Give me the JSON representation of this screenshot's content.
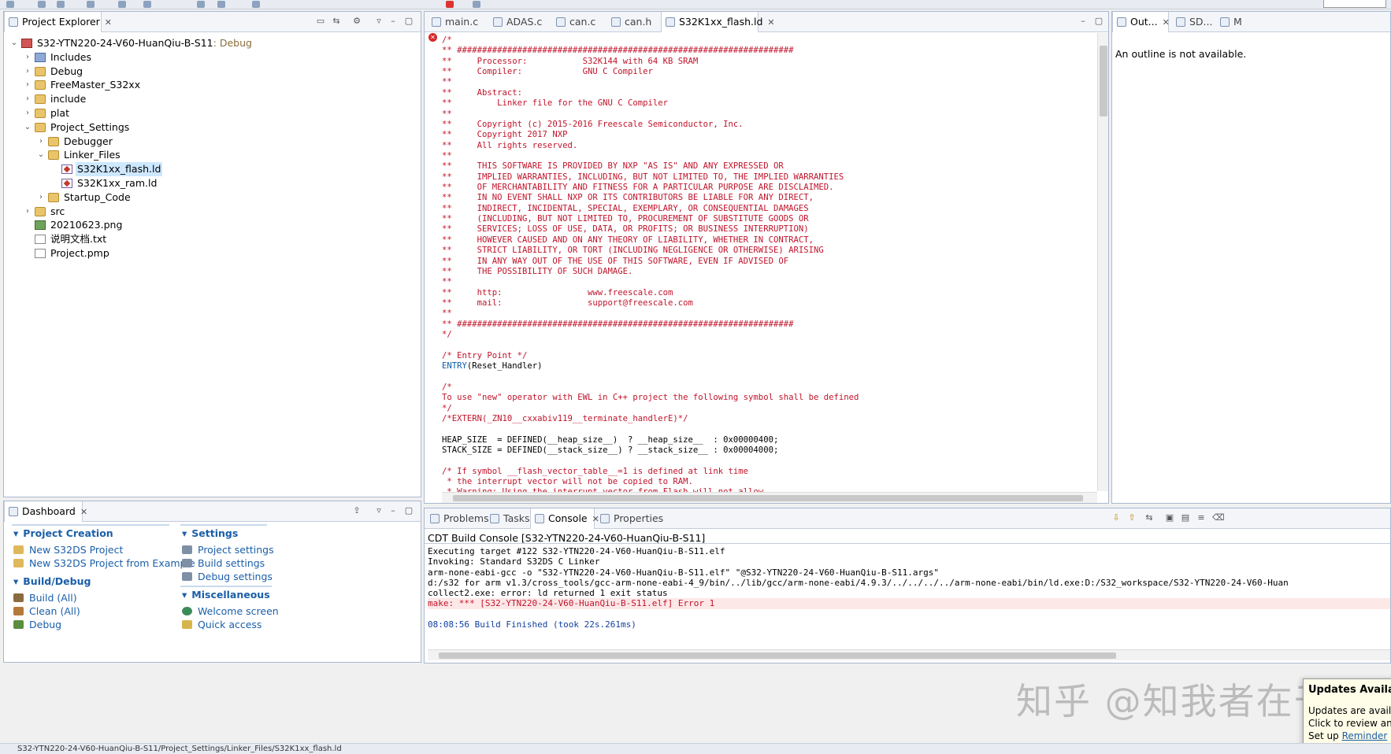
{
  "explorer": {
    "tab_label": "Project Explorer",
    "tree": [
      {
        "label": "S32-YTN220-24-V60-HuanQiu-B-S11",
        "decor": ": Debug",
        "depth": 0,
        "twisty": "open",
        "icon": "proj",
        "selected": false
      },
      {
        "label": "Includes",
        "depth": 1,
        "twisty": "closed",
        "icon": "incl"
      },
      {
        "label": "Debug",
        "depth": 1,
        "twisty": "closed",
        "icon": "folder"
      },
      {
        "label": "FreeMaster_S32xx",
        "depth": 1,
        "twisty": "closed",
        "icon": "folder"
      },
      {
        "label": "include",
        "depth": 1,
        "twisty": "closed",
        "icon": "folder"
      },
      {
        "label": "plat",
        "depth": 1,
        "twisty": "closed",
        "icon": "folder"
      },
      {
        "label": "Project_Settings",
        "depth": 1,
        "twisty": "open",
        "icon": "folder"
      },
      {
        "label": "Debugger",
        "depth": 2,
        "twisty": "closed",
        "icon": "folder"
      },
      {
        "label": "Linker_Files",
        "depth": 2,
        "twisty": "open",
        "icon": "folder"
      },
      {
        "label": "S32K1xx_flash.ld",
        "depth": 3,
        "twisty": "none",
        "icon": "ld",
        "selected": true
      },
      {
        "label": "S32K1xx_ram.ld",
        "depth": 3,
        "twisty": "none",
        "icon": "ld"
      },
      {
        "label": "Startup_Code",
        "depth": 2,
        "twisty": "closed",
        "icon": "folder"
      },
      {
        "label": "src",
        "depth": 1,
        "twisty": "closed",
        "icon": "folder"
      },
      {
        "label": "20210623.png",
        "depth": 1,
        "twisty": "none",
        "icon": "png"
      },
      {
        "label": "说明文档.txt",
        "depth": 1,
        "twisty": "none",
        "icon": "file"
      },
      {
        "label": "Project.pmp",
        "depth": 1,
        "twisty": "none",
        "icon": "file"
      }
    ]
  },
  "editor": {
    "tabs": [
      {
        "label": "main.c",
        "active": false
      },
      {
        "label": "ADAS.c",
        "active": false
      },
      {
        "label": "can.c",
        "active": false
      },
      {
        "label": "can.h",
        "active": false
      },
      {
        "label": "S32K1xx_flash.ld",
        "active": true
      }
    ],
    "lines": [
      {
        "t": "/*"
      },
      {
        "t": "** ###################################################################"
      },
      {
        "t": "**     Processor:           S32K144 with 64 KB SRAM"
      },
      {
        "t": "**     Compiler:            GNU C Compiler"
      },
      {
        "t": "**"
      },
      {
        "t": "**     Abstract:"
      },
      {
        "t": "**         Linker file for the GNU C Compiler"
      },
      {
        "t": "**"
      },
      {
        "t": "**     Copyright (c) 2015-2016 Freescale Semiconductor, Inc."
      },
      {
        "t": "**     Copyright 2017 NXP"
      },
      {
        "t": "**     All rights reserved."
      },
      {
        "t": "**"
      },
      {
        "t": "**     THIS SOFTWARE IS PROVIDED BY NXP \"AS IS\" AND ANY EXPRESSED OR"
      },
      {
        "t": "**     IMPLIED WARRANTIES, INCLUDING, BUT NOT LIMITED TO, THE IMPLIED WARRANTIES"
      },
      {
        "t": "**     OF MERCHANTABILITY AND FITNESS FOR A PARTICULAR PURPOSE ARE DISCLAIMED."
      },
      {
        "t": "**     IN NO EVENT SHALL NXP OR ITS CONTRIBUTORS BE LIABLE FOR ANY DIRECT,"
      },
      {
        "t": "**     INDIRECT, INCIDENTAL, SPECIAL, EXEMPLARY, OR CONSEQUENTIAL DAMAGES"
      },
      {
        "t": "**     (INCLUDING, BUT NOT LIMITED TO, PROCUREMENT OF SUBSTITUTE GOODS OR"
      },
      {
        "t": "**     SERVICES; LOSS OF USE, DATA, OR PROFITS; OR BUSINESS INTERRUPTION)"
      },
      {
        "t": "**     HOWEVER CAUSED AND ON ANY THEORY OF LIABILITY, WHETHER IN CONTRACT,"
      },
      {
        "t": "**     STRICT LIABILITY, OR TORT (INCLUDING NEGLIGENCE OR OTHERWISE) ARISING"
      },
      {
        "t": "**     IN ANY WAY OUT OF THE USE OF THIS SOFTWARE, EVEN IF ADVISED OF"
      },
      {
        "t": "**     THE POSSIBILITY OF SUCH DAMAGE."
      },
      {
        "t": "**"
      },
      {
        "t": "**     http:                 www.freescale.com"
      },
      {
        "t": "**     mail:                 support@freescale.com"
      },
      {
        "t": "**"
      },
      {
        "t": "** ###################################################################"
      },
      {
        "t": "*/"
      },
      {
        "t": ""
      },
      {
        "t": "/* Entry Point */"
      },
      {
        "t": "ENTRY(Reset_Handler)",
        "kw": "ENTRY",
        "rest": "(Reset_Handler)"
      },
      {
        "t": ""
      },
      {
        "t": "/*"
      },
      {
        "t": "To use \"new\" operator with EWL in C++ project the following symbol shall be defined"
      },
      {
        "t": "*/"
      },
      {
        "t": "/*EXTERN(_ZN10__cxxabiv119__terminate_handlerE)*/"
      },
      {
        "t": ""
      },
      {
        "t": "HEAP_SIZE  = DEFINED(__heap_size__)  ? __heap_size__  : 0x00000400;",
        "plain": true
      },
      {
        "t": "STACK_SIZE = DEFINED(__stack_size__) ? __stack_size__ : 0x00004000;",
        "plain": true
      },
      {
        "t": ""
      },
      {
        "t": "/* If symbol __flash_vector_table__=1 is defined at link time"
      },
      {
        "t": " * the interrupt vector will not be copied to RAM."
      },
      {
        "t": " * Warning: Using the interrupt vector from Flash will not allow"
      }
    ]
  },
  "outline": {
    "tabs": [
      {
        "label": "Out...",
        "active": true
      },
      {
        "label": "SD...",
        "active": false
      },
      {
        "label": "M",
        "active": false
      }
    ],
    "message": "An outline is not available."
  },
  "dashboard": {
    "tab_label": "Dashboard",
    "sections": {
      "project_creation": {
        "title": "Project Creation",
        "items": [
          "New S32DS Project",
          "New S32DS Project from Example"
        ]
      },
      "build_debug": {
        "title": "Build/Debug",
        "items": [
          "Build  (All)",
          "Clean  (All)",
          "Debug"
        ]
      },
      "settings": {
        "title": "Settings",
        "items": [
          "Project settings",
          "Build settings",
          "Debug settings"
        ]
      },
      "misc": {
        "title": "Miscellaneous",
        "items": [
          "Welcome screen",
          "Quick access"
        ]
      }
    }
  },
  "console": {
    "tabs": [
      {
        "label": "Problems",
        "active": false
      },
      {
        "label": "Tasks",
        "active": false
      },
      {
        "label": "Console",
        "active": true
      },
      {
        "label": "Properties",
        "active": false
      }
    ],
    "title": "CDT Build Console [S32-YTN220-24-V60-HuanQiu-B-S11]",
    "lines": [
      {
        "t": "Executing target #122 S32-YTN220-24-V60-HuanQiu-B-S11.elf",
        "kind": "normal"
      },
      {
        "t": "Invoking: Standard S32DS C Linker",
        "kind": "normal"
      },
      {
        "t": "arm-none-eabi-gcc -o \"S32-YTN220-24-V60-HuanQiu-B-S11.elf\" \"@S32-YTN220-24-V60-HuanQiu-B-S11.args\"",
        "kind": "normal"
      },
      {
        "t": "d:/s32 for arm v1.3/cross_tools/gcc-arm-none-eabi-4_9/bin/../lib/gcc/arm-none-eabi/4.9.3/../../../../arm-none-eabi/bin/ld.exe:D:/S32_workspace/S32-YTN220-24-V60-Huan",
        "kind": "normal"
      },
      {
        "t": "collect2.exe: error: ld returned 1 exit status",
        "kind": "normal"
      },
      {
        "t": "make: *** [S32-YTN220-24-V60-HuanQiu-B-S11.elf] Error 1",
        "kind": "err"
      },
      {
        "t": "",
        "kind": "normal"
      },
      {
        "t": "08:08:56 Build Finished (took 22s.261ms)",
        "kind": "blue"
      }
    ]
  },
  "notification": {
    "title": "Updates Available",
    "line1": "Updates are avail",
    "line2": "Click to review an",
    "line3_prefix": "Set up ",
    "line3_link": "Reminder"
  },
  "watermark": "知乎 @知我者在于",
  "statusbar": "S32-YTN220-24-V60-HuanQiu-B-S11/Project_Settings/Linker_Files/S32K1xx_flash.ld"
}
